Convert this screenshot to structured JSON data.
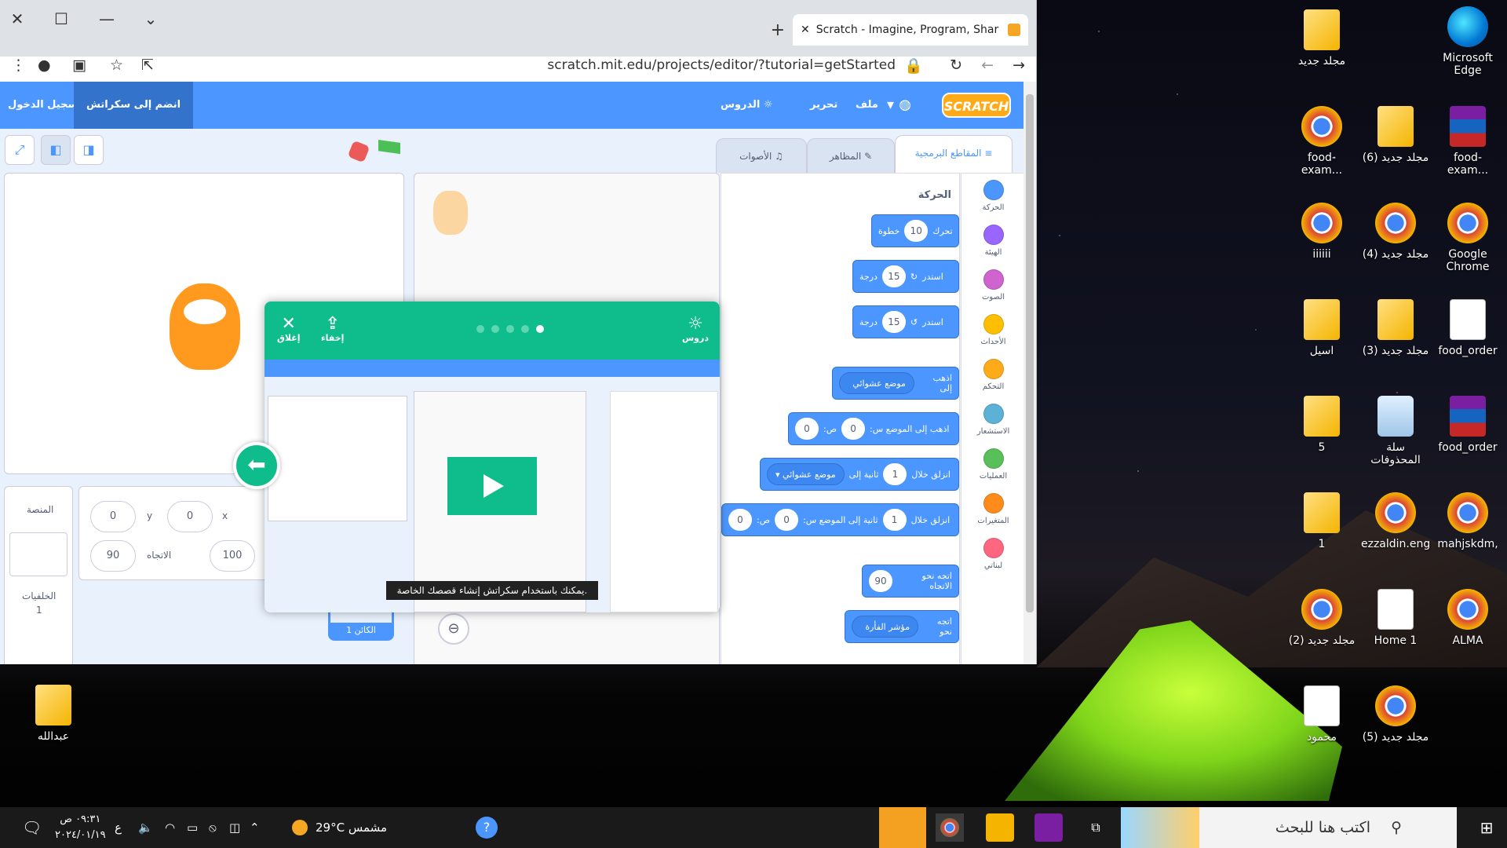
{
  "browser": {
    "tab_title": "Scratch - Imagine, Program, Shar",
    "url": "scratch.mit.edu/projects/editor/?tutorial=getStarted"
  },
  "menubar": {
    "logo": "SCRATCH",
    "file": "ملف",
    "edit": "تحرير",
    "tutorials": "الدروس",
    "join": "انضم إلى سكراتش",
    "signin": "تسجيل الدخول"
  },
  "editor_tabs": {
    "code": "المقاطع البرمجية",
    "costumes": "المظاهر",
    "sounds": "الأصوات"
  },
  "categories": [
    {
      "label": "الحركة",
      "color": "#4c97ff"
    },
    {
      "label": "الهيئة",
      "color": "#9966ff"
    },
    {
      "label": "الصوت",
      "color": "#cf63cf"
    },
    {
      "label": "الأحداث",
      "color": "#ffbf00"
    },
    {
      "label": "التحكم",
      "color": "#ffab19"
    },
    {
      "label": "الاستشعار",
      "color": "#5cb1d6"
    },
    {
      "label": "العمليات",
      "color": "#59c059"
    },
    {
      "label": "المتغيرات",
      "color": "#ff8c1a"
    },
    {
      "label": "لبناتي",
      "color": "#ff6680"
    }
  ],
  "palette": {
    "section": "الحركة",
    "move": {
      "a": "تحرك",
      "val": "10",
      "b": "خطوة"
    },
    "turn_right": {
      "a": "استدر",
      "val": "15",
      "b": "درجة"
    },
    "turn_left": {
      "a": "استدر",
      "val": "15",
      "b": "درجة"
    },
    "goto": {
      "a": "اذهب إلى",
      "dd": "موضع عشوائي"
    },
    "goto_xy": {
      "a": "اذهب إلى الموضع س:",
      "x": "0",
      "b": "ص:",
      "y": "0"
    },
    "glide": {
      "a": "انزلق خلال",
      "val": "1",
      "b": "ثانية إلى",
      "dd": "موضع عشوائي"
    },
    "glide_xy": {
      "a": "انزلق خلال",
      "val": "1",
      "b": "ثانية إلى الموضع س:",
      "x": "0",
      "c": "ص:",
      "y": "0"
    },
    "point_dir": {
      "a": "اتجه نحو الاتجاه",
      "val": "90"
    },
    "point_to": {
      "a": "اتجه نحو",
      "dd": "مؤشر الفأرة"
    }
  },
  "sprite_info": {
    "x": "0",
    "y": "0",
    "x_label": "x",
    "y_label": "y",
    "size": "100",
    "direction": "90",
    "direction_label": "الاتجاه"
  },
  "stage_pane": {
    "title": "المنصة",
    "backdrops": "الخلفيات",
    "count": "1"
  },
  "sprite_thumb": "الكائن 1",
  "tutorial": {
    "tutorials": "دروس",
    "minimize": "إخفاء",
    "close": "إغلاق",
    "caption": "يمكنك باستخدام سكراتش إنشاء قصصك الخاصة."
  },
  "desktop_icons": [
    {
      "label": "مجلد جديد",
      "type": "folder"
    },
    {
      "label": "Microsoft Edge",
      "type": "edge"
    },
    {
      "label": "food-exam...",
      "type": "chrome"
    },
    {
      "label": "مجلد جديد (6)",
      "type": "folder"
    },
    {
      "label": "food-exam...",
      "type": "rar"
    },
    {
      "label": "iiiiii",
      "type": "chrome"
    },
    {
      "label": "مجلد جديد (4)",
      "type": "chrome"
    },
    {
      "label": "Google Chrome",
      "type": "chrome"
    },
    {
      "label": "اسيل",
      "type": "folder"
    },
    {
      "label": "مجلد جديد (3)",
      "type": "folder"
    },
    {
      "label": "food_order",
      "type": "doc"
    },
    {
      "label": "5",
      "type": "folder"
    },
    {
      "label": "سلة المحذوفات",
      "type": "bin"
    },
    {
      "label": "food_order",
      "type": "rar"
    },
    {
      "label": "1",
      "type": "folder"
    },
    {
      "label": "ezzaldin.eng",
      "type": "chrome"
    },
    {
      "label": "mahjskdm,",
      "type": "chrome"
    },
    {
      "label": "مجلد جديد (2)",
      "type": "chrome"
    },
    {
      "label": "Home 1",
      "type": "doc"
    },
    {
      "label": "ALMA",
      "type": "chrome"
    },
    {
      "label": "محمود",
      "type": "doc"
    },
    {
      "label": "مجلد جديد (5)",
      "type": "chrome"
    },
    {
      "label": "عبدالله",
      "type": "folder"
    }
  ],
  "taskbar": {
    "search_placeholder": "اكتب هنا للبحث",
    "weather": "29°C مشمس",
    "time": "٠٩:٣١ ص",
    "date": "٢٠٢٤/٠١/١٩",
    "lang": "ع"
  }
}
